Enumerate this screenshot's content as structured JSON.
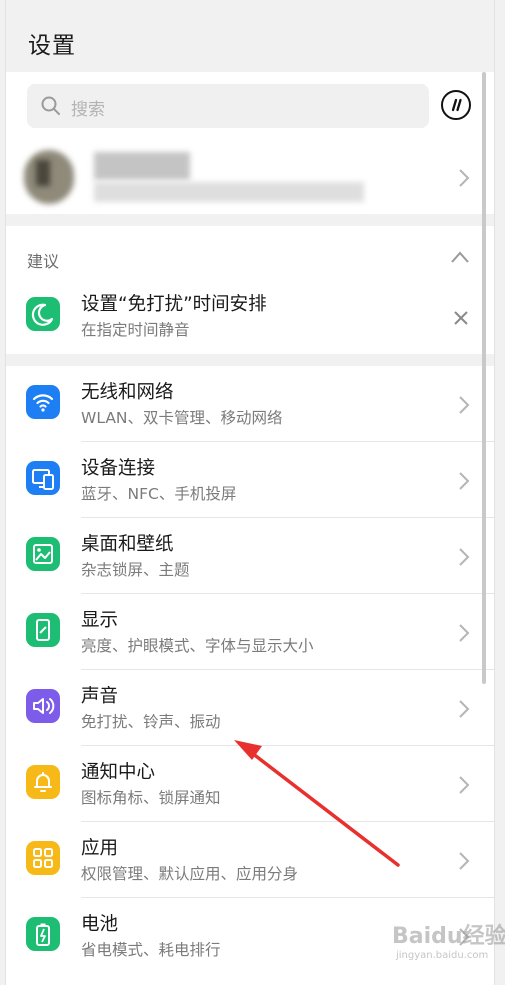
{
  "header": {
    "title": "设置"
  },
  "search": {
    "placeholder": "搜索"
  },
  "suggestion": {
    "section_label": "建议",
    "title": "设置“免打扰”时间安排",
    "subtitle": "在指定时间静音"
  },
  "settings_items": [
    {
      "title": "无线和网络",
      "subtitle": "WLAN、双卡管理、移动网络",
      "icon": "wifi-icon",
      "color": "#1e7ff5"
    },
    {
      "title": "设备连接",
      "subtitle": "蓝牙、NFC、手机投屏",
      "icon": "device-connect-icon",
      "color": "#1e7ff5"
    },
    {
      "title": "桌面和壁纸",
      "subtitle": "杂志锁屏、主题",
      "icon": "wallpaper-icon",
      "color": "#1dbd74"
    },
    {
      "title": "显示",
      "subtitle": "亮度、护眼模式、字体与显示大小",
      "icon": "display-icon",
      "color": "#1dbd74"
    },
    {
      "title": "声音",
      "subtitle": "免打扰、铃声、振动",
      "icon": "sound-icon",
      "color": "#7c5ce8"
    },
    {
      "title": "通知中心",
      "subtitle": "图标角标、锁屏通知",
      "icon": "bell-icon",
      "color": "#f6b917"
    },
    {
      "title": "应用",
      "subtitle": "权限管理、默认应用、应用分身",
      "icon": "apps-icon",
      "color": "#f6b917"
    },
    {
      "title": "电池",
      "subtitle": "省电模式、耗电排行",
      "icon": "battery-icon",
      "color": "#1dbd74"
    }
  ],
  "colors": {
    "moon_icon": "#1dbd74",
    "annotation_arrow": "#e8312f"
  },
  "watermark": {
    "text": "Baidu经验",
    "sub": "jingyan.baidu.com"
  }
}
